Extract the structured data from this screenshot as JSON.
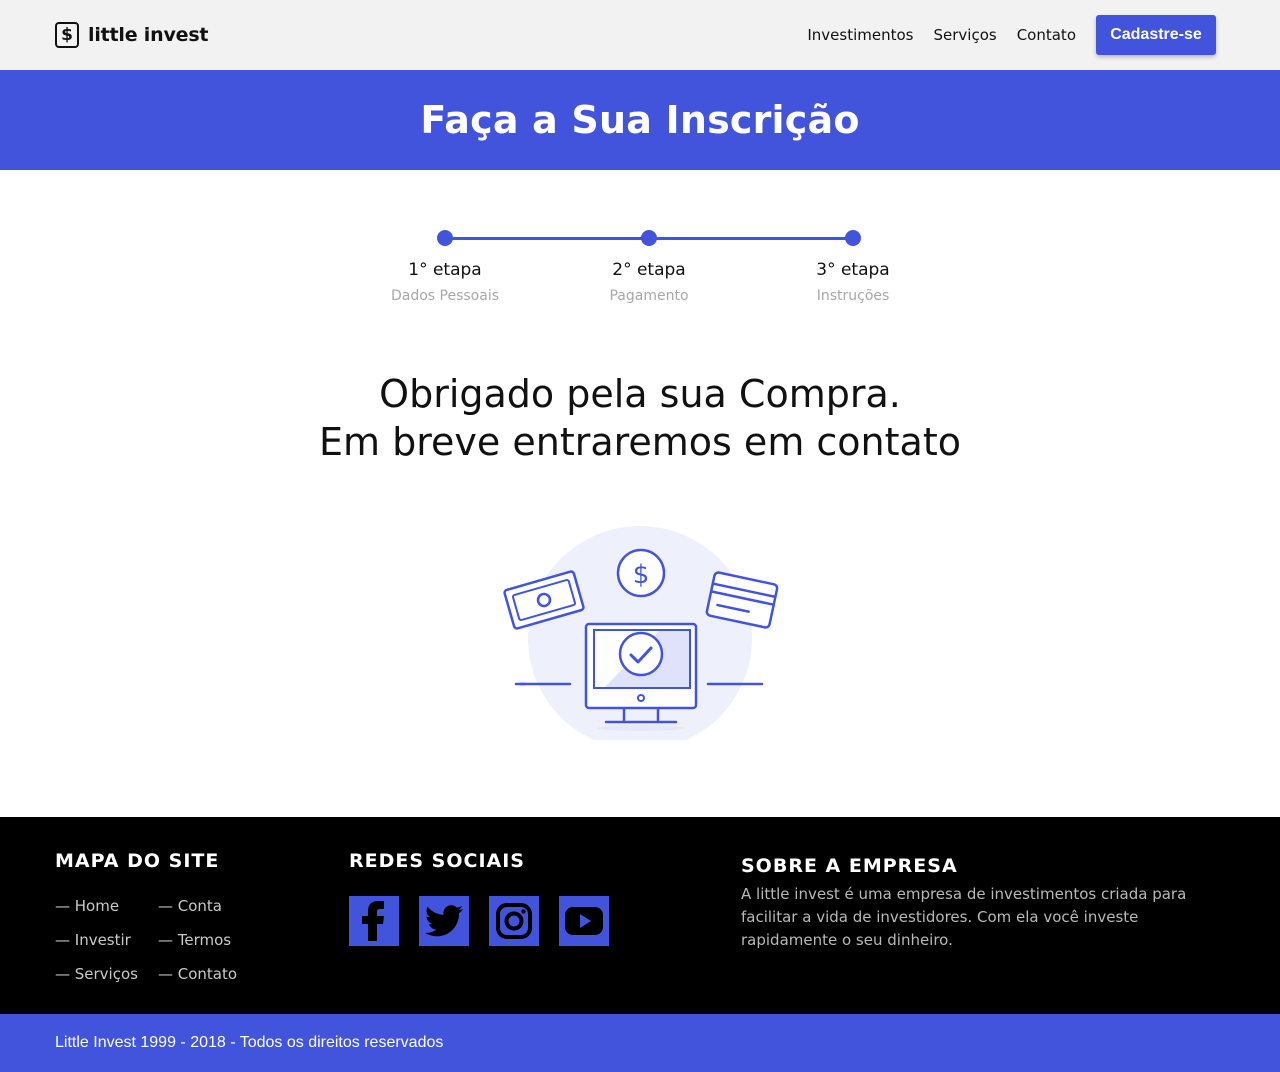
{
  "header": {
    "logo_icon": "dollar-icon",
    "logo_text": "little invest",
    "nav": [
      "Investimentos",
      "Serviços",
      "Contato"
    ],
    "cta_label": "Cadastre-se"
  },
  "banner": {
    "title": "Faça a Sua Inscrição"
  },
  "steps": [
    {
      "title": "1° etapa",
      "subtitle": "Dados Pessoais"
    },
    {
      "title": "2° etapa",
      "subtitle": "Pagamento"
    },
    {
      "title": "3° etapa",
      "subtitle": "Instruções"
    }
  ],
  "thanks": {
    "line1": "Obrigado pela sua Compra.",
    "line2": "Em breve entraremos em contato"
  },
  "illustration": {
    "icons": [
      "banknote-icon",
      "coin-dollar-icon",
      "credit-card-icon",
      "monitor-check-icon"
    ]
  },
  "footer": {
    "sitemap_title": "MAPA DO SITE",
    "sitemap": [
      "— Home",
      "— Conta",
      "— Investir",
      "— Termos",
      "— Serviços",
      "— Contato"
    ],
    "social_title": "REDES SOCIAIS",
    "social": [
      "facebook-icon",
      "twitter-icon",
      "instagram-icon",
      "youtube-icon"
    ],
    "about_title": "SOBRE A EMPRESA",
    "about_text": "A little invest é uma empresa de investimentos criada para facilitar a vida de investidores. Com ela você investe rapidamente o seu dinheiro."
  },
  "copyright": "Little Invest 1999 - 2018 - Todos os direitos reservados",
  "colors": {
    "accent": "#4254dc",
    "header_bg": "#f2f2f2",
    "footer_bg": "#000000"
  }
}
